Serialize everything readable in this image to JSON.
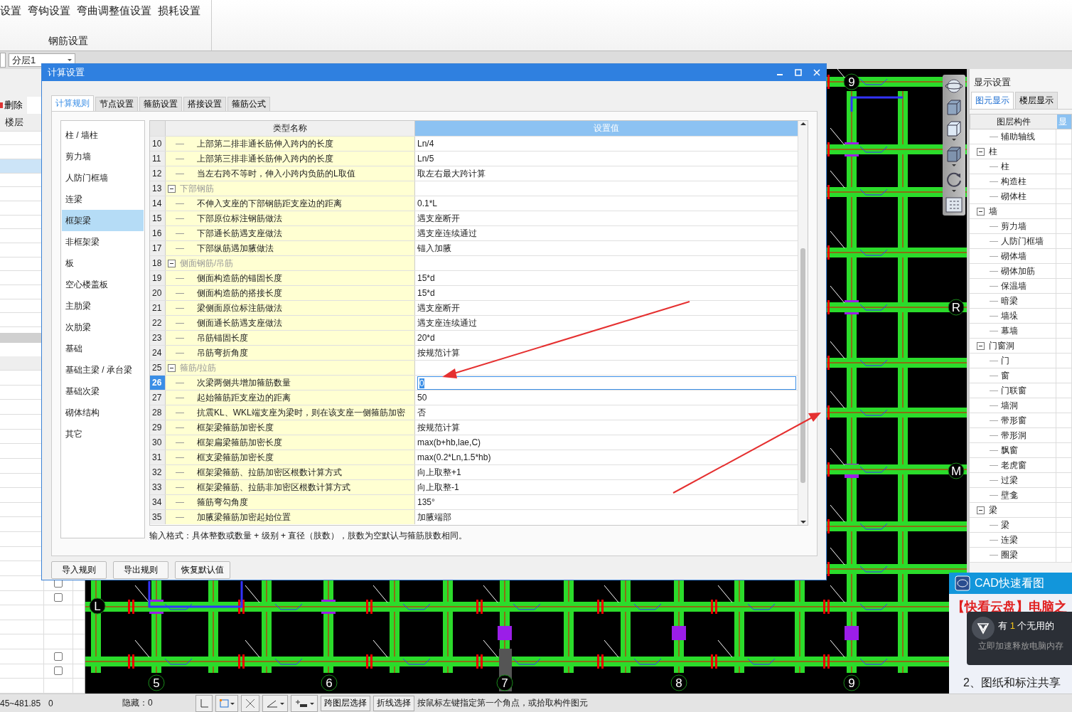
{
  "ribbon": {
    "menu_items": [
      "设置",
      "弯钩设置",
      "弯曲调整值设置",
      "损耗设置"
    ],
    "group_label": "钢筋设置"
  },
  "toolbar": {
    "floor_dropdown": "分层1"
  },
  "left_panel": {
    "delete_button": "删除",
    "header": "楼层",
    "rows": [
      {
        "selected": false
      },
      {
        "selected": false
      },
      {
        "selected": true
      },
      {
        "selected": false
      },
      {
        "selected": false
      },
      {
        "selected": false
      },
      {
        "selected": false
      },
      {
        "selected": false
      },
      {
        "selected": false
      },
      {
        "selected": false
      },
      {
        "selected": false
      },
      {
        "selected": false
      },
      {
        "selected": false
      },
      {
        "selected": false
      }
    ],
    "lower_rows": [
      {
        "kind": "plain"
      },
      {
        "kind": "plain"
      },
      {
        "kind": "plain"
      },
      {
        "kind": "plain"
      },
      {
        "kind": "plain"
      },
      {
        "kind": "plain"
      },
      {
        "kind": "plain"
      },
      {
        "kind": "plain"
      },
      {
        "kind": "plain"
      },
      {
        "kind": "plain"
      },
      {
        "kind": "plain"
      },
      {
        "kind": "plain"
      },
      {
        "kind": "plain"
      },
      {
        "kind": "plain"
      },
      {
        "kind": "checkbox",
        "checked": false
      },
      {
        "kind": "checkbox",
        "checked": false
      },
      {
        "kind": "plain"
      },
      {
        "kind": "plain"
      },
      {
        "kind": "plain"
      },
      {
        "kind": "checkbox",
        "checked": false
      },
      {
        "kind": "checkbox",
        "checked": false
      },
      {
        "kind": "plain"
      }
    ]
  },
  "cad": {
    "axis_labels": [
      "9",
      "5",
      "6",
      "7",
      "8",
      "9",
      "L",
      "R",
      "M"
    ]
  },
  "dialog": {
    "title": "计算设置",
    "tabs": [
      {
        "label": "计算规则",
        "selected": true
      },
      {
        "label": "节点设置",
        "selected": false
      },
      {
        "label": "箍筋设置",
        "selected": false
      },
      {
        "label": "搭接设置",
        "selected": false
      },
      {
        "label": "箍筋公式",
        "selected": false
      }
    ],
    "categories": [
      {
        "label": "柱 / 墙柱",
        "selected": false
      },
      {
        "label": "剪力墙",
        "selected": false
      },
      {
        "label": "人防门框墙",
        "selected": false
      },
      {
        "label": "连梁",
        "selected": false
      },
      {
        "label": "框架梁",
        "selected": true
      },
      {
        "label": "非框架梁",
        "selected": false
      },
      {
        "label": "板",
        "selected": false
      },
      {
        "label": "空心楼盖板",
        "selected": false
      },
      {
        "label": "主肋梁",
        "selected": false
      },
      {
        "label": "次肋梁",
        "selected": false
      },
      {
        "label": "基础",
        "selected": false
      },
      {
        "label": "基础主梁 / 承台梁",
        "selected": false
      },
      {
        "label": "基础次梁",
        "selected": false
      },
      {
        "label": "砌体结构",
        "selected": false
      },
      {
        "label": "其它",
        "selected": false
      }
    ],
    "table": {
      "columns": [
        "类型名称",
        "设置值"
      ],
      "rows": [
        {
          "kind": "item",
          "num": "10",
          "name": "上部第二排非通长筋伸入跨内的长度",
          "value": "Ln/4",
          "selected": false
        },
        {
          "kind": "item",
          "num": "11",
          "name": "上部第三排非通长筋伸入跨内的长度",
          "value": "Ln/5",
          "selected": false
        },
        {
          "kind": "item",
          "num": "12",
          "name": "当左右跨不等时，伸入小跨内负筋的L取值",
          "value": "取左右最大跨计算",
          "selected": false
        },
        {
          "kind": "group",
          "num": "13",
          "name": "下部钢筋",
          "expanded": true,
          "selected": false
        },
        {
          "kind": "item",
          "num": "14",
          "name": "不伸入支座的下部钢筋距支座边的距离",
          "value": "0.1*L",
          "selected": false
        },
        {
          "kind": "item",
          "num": "15",
          "name": "下部原位标注钢筋做法",
          "value": "遇支座断开",
          "selected": false
        },
        {
          "kind": "item",
          "num": "16",
          "name": "下部通长筋遇支座做法",
          "value": "遇支座连续通过",
          "selected": false
        },
        {
          "kind": "item",
          "num": "17",
          "name": "下部纵筋遇加腋做法",
          "value": "锚入加腋",
          "selected": false
        },
        {
          "kind": "group",
          "num": "18",
          "name": "侧面钢筋/吊筋",
          "expanded": true,
          "selected": false
        },
        {
          "kind": "item",
          "num": "19",
          "name": "侧面构造筋的锚固长度",
          "value": "15*d",
          "selected": false
        },
        {
          "kind": "item",
          "num": "20",
          "name": "侧面构造筋的搭接长度",
          "value": "15*d",
          "selected": false
        },
        {
          "kind": "item",
          "num": "21",
          "name": "梁侧面原位标注筋做法",
          "value": "遇支座断开",
          "selected": false
        },
        {
          "kind": "item",
          "num": "22",
          "name": "侧面通长筋遇支座做法",
          "value": "遇支座连续通过",
          "selected": false
        },
        {
          "kind": "item",
          "num": "23",
          "name": "吊筋锚固长度",
          "value": "20*d",
          "selected": false
        },
        {
          "kind": "item",
          "num": "24",
          "name": "吊筋弯折角度",
          "value": "按规范计算",
          "selected": false
        },
        {
          "kind": "group",
          "num": "25",
          "name": "箍筋/拉筋",
          "expanded": true,
          "selected": false
        },
        {
          "kind": "item",
          "num": "26",
          "name": "次梁两侧共增加箍筋数量",
          "value": "0",
          "selected": true
        },
        {
          "kind": "item",
          "num": "27",
          "name": "起始箍筋距支座边的距离",
          "value": "50",
          "selected": false
        },
        {
          "kind": "item",
          "num": "28",
          "name": "抗震KL、WKL端支座为梁时，则在该支座一侧箍筋加密",
          "value": "否",
          "selected": false
        },
        {
          "kind": "item",
          "num": "29",
          "name": "框架梁箍筋加密长度",
          "value": "按规范计算",
          "selected": false
        },
        {
          "kind": "item",
          "num": "30",
          "name": "框架扁梁箍筋加密长度",
          "value": "max(b+hb,lae,C)",
          "selected": false
        },
        {
          "kind": "item",
          "num": "31",
          "name": "框支梁箍筋加密长度",
          "value": "max(0.2*Ln,1.5*hb)",
          "selected": false
        },
        {
          "kind": "item",
          "num": "32",
          "name": "框架梁箍筋、拉筋加密区根数计算方式",
          "value": "向上取整+1",
          "selected": false
        },
        {
          "kind": "item",
          "num": "33",
          "name": "框架梁箍筋、拉筋非加密区根数计算方式",
          "value": "向上取整-1",
          "selected": false
        },
        {
          "kind": "item",
          "num": "34",
          "name": "箍筋弯勾角度",
          "value": "135°",
          "selected": false
        },
        {
          "kind": "item",
          "num": "35",
          "name": "加腋梁箍筋加密起始位置",
          "value": "加腋端部",
          "selected": false
        }
      ]
    },
    "hint": "输入格式：具体整数或数量 + 级别 + 直径（肢数），肢数为空默认与箍筋肢数相同。",
    "buttons": [
      "导入规则",
      "导出规则",
      "恢复默认值"
    ]
  },
  "right_panel": {
    "title": "显示设置",
    "tabs": [
      {
        "label": "图元显示",
        "selected": true
      },
      {
        "label": "楼层显示",
        "selected": false
      }
    ],
    "columns": [
      "图层构件",
      "显"
    ],
    "tree": [
      {
        "label": "辅助轴线"
      },
      {
        "label": "柱",
        "expanded": true,
        "children": [
          {
            "label": "柱"
          },
          {
            "label": "构造柱"
          },
          {
            "label": "砌体柱"
          }
        ]
      },
      {
        "label": "墙",
        "expanded": true,
        "children": [
          {
            "label": "剪力墙"
          },
          {
            "label": "人防门框墙"
          },
          {
            "label": "砌体墙"
          },
          {
            "label": "砌体加筋"
          },
          {
            "label": "保温墙"
          },
          {
            "label": "暗梁"
          },
          {
            "label": "墙垛"
          },
          {
            "label": "幕墙"
          }
        ]
      },
      {
        "label": "门窗洞",
        "expanded": true,
        "children": [
          {
            "label": "门"
          },
          {
            "label": "窗"
          },
          {
            "label": "门联窗"
          },
          {
            "label": "墙洞"
          },
          {
            "label": "带形窗"
          },
          {
            "label": "带形洞"
          },
          {
            "label": "飘窗"
          },
          {
            "label": "老虎窗"
          },
          {
            "label": "过梁"
          },
          {
            "label": "壁龛"
          }
        ]
      },
      {
        "label": "梁",
        "expanded": true,
        "children": [
          {
            "label": "梁"
          },
          {
            "label": "连梁"
          },
          {
            "label": "圈梁"
          }
        ]
      }
    ]
  },
  "status_bar": {
    "coordinates": "45~481.85",
    "value": "0",
    "hidden": "隐藏：0",
    "buttons": [
      "跨图层选择",
      "折线选择"
    ],
    "prompt": "按鼠标左键指定第一个角点，或拾取构件图元"
  },
  "cad_popup": {
    "title": "CAD快速看图",
    "headline": "【快看云盘】电脑之",
    "line": "2、图纸和标注共享"
  },
  "notification": {
    "prefix": "有",
    "count": "1",
    "suffix": "个无用的",
    "action": "立即加速释放电脑内存"
  }
}
